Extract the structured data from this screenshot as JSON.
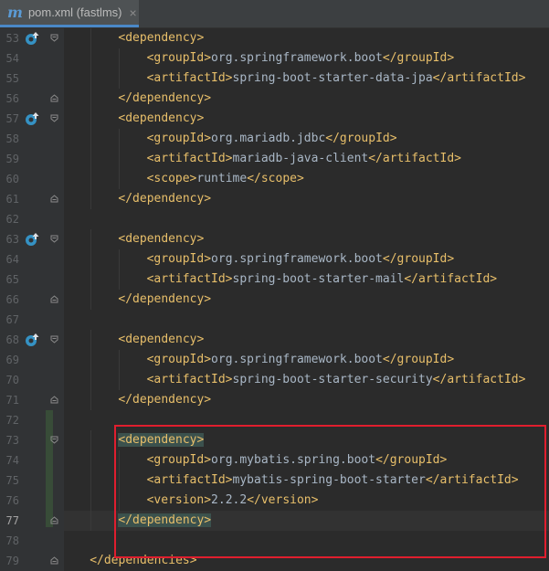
{
  "tab": {
    "icon": "maven-m-icon",
    "icon_glyph": "m",
    "label": "pom.xml (fastlms)",
    "close_glyph": "×"
  },
  "editor": {
    "current_line": 77,
    "lines": [
      {
        "n": "53",
        "indent": 2,
        "maven": true,
        "fold": "open",
        "parts": [
          {
            "t": "<dependency>",
            "c": "tag"
          }
        ]
      },
      {
        "n": "54",
        "indent": 3,
        "parts": [
          {
            "t": "<groupId>",
            "c": "tag"
          },
          {
            "t": "org.springframework.boot",
            "c": "txt"
          },
          {
            "t": "</groupId>",
            "c": "tag"
          }
        ]
      },
      {
        "n": "55",
        "indent": 3,
        "parts": [
          {
            "t": "<artifactId>",
            "c": "tag"
          },
          {
            "t": "spring-boot-starter-data-jpa",
            "c": "txt"
          },
          {
            "t": "</artifactId>",
            "c": "tag"
          }
        ]
      },
      {
        "n": "56",
        "indent": 2,
        "fold": "close",
        "parts": [
          {
            "t": "</dependency>",
            "c": "tag"
          }
        ]
      },
      {
        "n": "57",
        "indent": 2,
        "maven": true,
        "fold": "open",
        "parts": [
          {
            "t": "<dependency>",
            "c": "tag"
          }
        ]
      },
      {
        "n": "58",
        "indent": 3,
        "parts": [
          {
            "t": "<groupId>",
            "c": "tag"
          },
          {
            "t": "org.mariadb.jdbc",
            "c": "txt"
          },
          {
            "t": "</groupId>",
            "c": "tag"
          }
        ]
      },
      {
        "n": "59",
        "indent": 3,
        "parts": [
          {
            "t": "<artifactId>",
            "c": "tag"
          },
          {
            "t": "mariadb-java-client",
            "c": "txt"
          },
          {
            "t": "</artifactId>",
            "c": "tag"
          }
        ]
      },
      {
        "n": "60",
        "indent": 3,
        "parts": [
          {
            "t": "<scope>",
            "c": "tag"
          },
          {
            "t": "runtime",
            "c": "txt"
          },
          {
            "t": "</scope>",
            "c": "tag"
          }
        ]
      },
      {
        "n": "61",
        "indent": 2,
        "fold": "close",
        "parts": [
          {
            "t": "</dependency>",
            "c": "tag"
          }
        ]
      },
      {
        "n": "62",
        "indent": 0,
        "parts": []
      },
      {
        "n": "63",
        "indent": 2,
        "maven": true,
        "fold": "open",
        "parts": [
          {
            "t": "<dependency>",
            "c": "tag"
          }
        ]
      },
      {
        "n": "64",
        "indent": 3,
        "parts": [
          {
            "t": "<groupId>",
            "c": "tag"
          },
          {
            "t": "org.springframework.boot",
            "c": "txt"
          },
          {
            "t": "</groupId>",
            "c": "tag"
          }
        ]
      },
      {
        "n": "65",
        "indent": 3,
        "parts": [
          {
            "t": "<artifactId>",
            "c": "tag"
          },
          {
            "t": "spring-boot-starter-mail",
            "c": "txt"
          },
          {
            "t": "</artifactId>",
            "c": "tag"
          }
        ]
      },
      {
        "n": "66",
        "indent": 2,
        "fold": "close",
        "parts": [
          {
            "t": "</dependency>",
            "c": "tag"
          }
        ]
      },
      {
        "n": "67",
        "indent": 0,
        "parts": []
      },
      {
        "n": "68",
        "indent": 2,
        "maven": true,
        "fold": "open",
        "parts": [
          {
            "t": "<dependency>",
            "c": "tag"
          }
        ]
      },
      {
        "n": "69",
        "indent": 3,
        "parts": [
          {
            "t": "<groupId>",
            "c": "tag"
          },
          {
            "t": "org.springframework.boot",
            "c": "txt"
          },
          {
            "t": "</groupId>",
            "c": "tag"
          }
        ]
      },
      {
        "n": "70",
        "indent": 3,
        "parts": [
          {
            "t": "<artifactId>",
            "c": "tag"
          },
          {
            "t": "spring-boot-starter-security",
            "c": "txt"
          },
          {
            "t": "</artifactId>",
            "c": "tag"
          }
        ]
      },
      {
        "n": "71",
        "indent": 2,
        "fold": "close",
        "parts": [
          {
            "t": "</dependency>",
            "c": "tag"
          }
        ]
      },
      {
        "n": "72",
        "indent": 0,
        "parts": []
      },
      {
        "n": "73",
        "indent": 2,
        "fold": "open",
        "parts": [
          {
            "t": "<dependency>",
            "c": "tag match"
          }
        ]
      },
      {
        "n": "74",
        "indent": 3,
        "parts": [
          {
            "t": "<groupId>",
            "c": "tag"
          },
          {
            "t": "org.mybatis.spring.boot",
            "c": "txt"
          },
          {
            "t": "</groupId>",
            "c": "tag"
          }
        ]
      },
      {
        "n": "75",
        "indent": 3,
        "parts": [
          {
            "t": "<artifactId>",
            "c": "tag"
          },
          {
            "t": "mybatis-spring-boot-starter",
            "c": "txt"
          },
          {
            "t": "</artifactId>",
            "c": "tag"
          }
        ]
      },
      {
        "n": "76",
        "indent": 3,
        "parts": [
          {
            "t": "<version>",
            "c": "tag"
          },
          {
            "t": "2.2.2",
            "c": "txt"
          },
          {
            "t": "</version>",
            "c": "tag"
          }
        ]
      },
      {
        "n": "77",
        "indent": 2,
        "fold": "close",
        "parts": [
          {
            "t": "</dependency>",
            "c": "tag match"
          }
        ]
      },
      {
        "n": "78",
        "indent": 0,
        "parts": []
      },
      {
        "n": "79",
        "indent": 1,
        "fold": "close",
        "parts": [
          {
            "t": "</dependencies>",
            "c": "tag"
          }
        ]
      }
    ]
  },
  "colors": {
    "background": "#2b2b2b",
    "gutter": "#313335",
    "tag": "#e8bf6a",
    "text": "#a9b7c6",
    "line_number": "#606366",
    "highlight_box": "#e01e2e",
    "change_marker": "#384c38"
  }
}
